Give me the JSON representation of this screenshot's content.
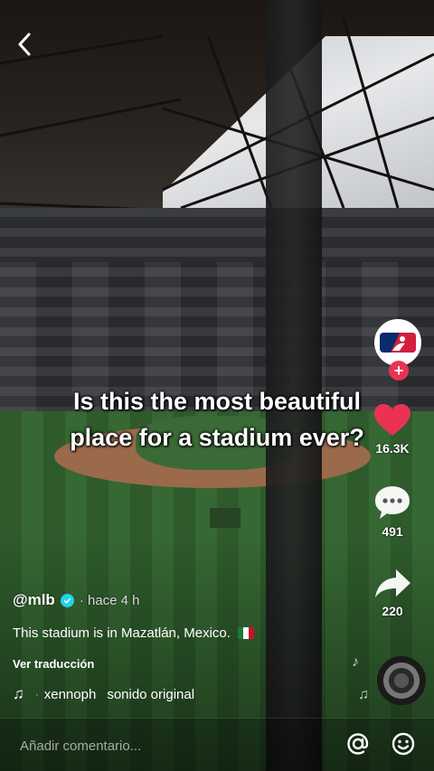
{
  "header": {
    "back_icon": "chevron-left-icon"
  },
  "video": {
    "caption_line1": "Is this the most beautiful",
    "caption_line2": "place for a stadium ever?"
  },
  "rail": {
    "avatar_icon": "mlb-logo",
    "follow_icon": "plus-icon",
    "like": {
      "icon": "heart-icon",
      "count": "16.3K",
      "color": "#ea3354"
    },
    "comments": {
      "icon": "comment-bubble-icon",
      "count": "491"
    },
    "share": {
      "icon": "share-arrow-icon",
      "count": "220"
    }
  },
  "post": {
    "username": "@mlb",
    "time": "· hace 4 h",
    "description": "This stadium is in Mazatlán, Mexico.",
    "translate_label": "Ver traducción",
    "music_author": "xennoph",
    "music_title": "sonido original"
  },
  "comment_bar": {
    "placeholder": "Añadir comentario...",
    "mention_icon": "at-icon",
    "emoji_icon": "emoji-icon"
  },
  "colors": {
    "accent": "#ea3354",
    "verified": "#20d5ec"
  }
}
